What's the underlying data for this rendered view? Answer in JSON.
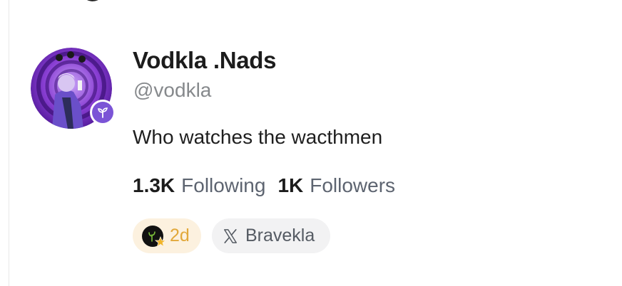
{
  "profile": {
    "display_name": "Vodkla .Nads",
    "handle": "@vodkla",
    "bio": "Who watches the wacthmen"
  },
  "stats": {
    "following_count": "1.3K",
    "following_label": "Following",
    "followers_count": "1K",
    "followers_label": "Followers"
  },
  "chips": {
    "age": "2d",
    "x_account": "Bravekla"
  },
  "icons": {
    "avatar_badge": "sprout-icon",
    "age_chip_badge": "star-icon",
    "x_chip": "x-logo-icon",
    "top_partial": "search-icon"
  },
  "colors": {
    "badge_purple": "#7b54d6",
    "age_chip_bg": "#fcf1df",
    "age_text": "#e2a83a",
    "x_chip_bg": "#f2f2f3",
    "muted_text": "#86898c",
    "stat_label": "#5d6470"
  }
}
